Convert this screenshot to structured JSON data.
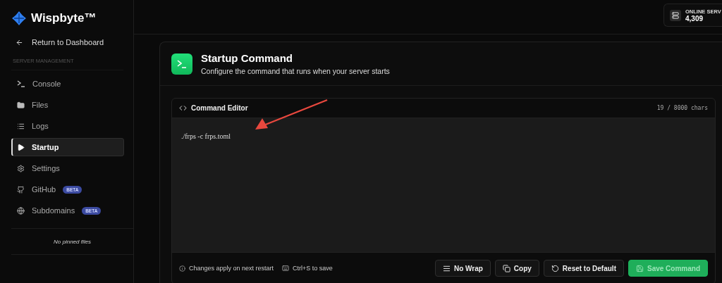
{
  "brand": {
    "name": "Wispbyte™"
  },
  "sidebar": {
    "back_link": "Return to Dashboard",
    "section_label": "SERVER MANAGEMENT",
    "items": [
      {
        "label": "Console",
        "selected": false
      },
      {
        "label": "Files",
        "selected": false
      },
      {
        "label": "Logs",
        "selected": false
      },
      {
        "label": "Startup",
        "selected": true
      },
      {
        "label": "Settings",
        "selected": false
      },
      {
        "label": "GitHub",
        "badge": "BETA",
        "selected": false
      },
      {
        "label": "Subdomains",
        "badge": "BETA",
        "selected": false
      }
    ],
    "pinned_empty": "No pinned files"
  },
  "top_bar": {
    "stat_label": "ONLINE SERV",
    "stat_value": "4,309"
  },
  "card": {
    "title": "Startup Command",
    "subtitle": "Configure the command that runs when your server starts"
  },
  "editor": {
    "title": "Command Editor",
    "counter": "19 / 8000 chars",
    "value": "./frps -c frps.toml",
    "hints": [
      "Changes apply on next restart",
      "Ctrl+S to save"
    ],
    "buttons": [
      {
        "label": "No Wrap",
        "kind": "wrap",
        "disabled": false
      },
      {
        "label": "Copy",
        "kind": "copy",
        "disabled": false
      },
      {
        "label": "Reset to Default",
        "kind": "reset",
        "disabled": false
      },
      {
        "label": "Save Command",
        "kind": "save",
        "disabled": true
      }
    ]
  },
  "annotation": {
    "kind": "arrow"
  }
}
